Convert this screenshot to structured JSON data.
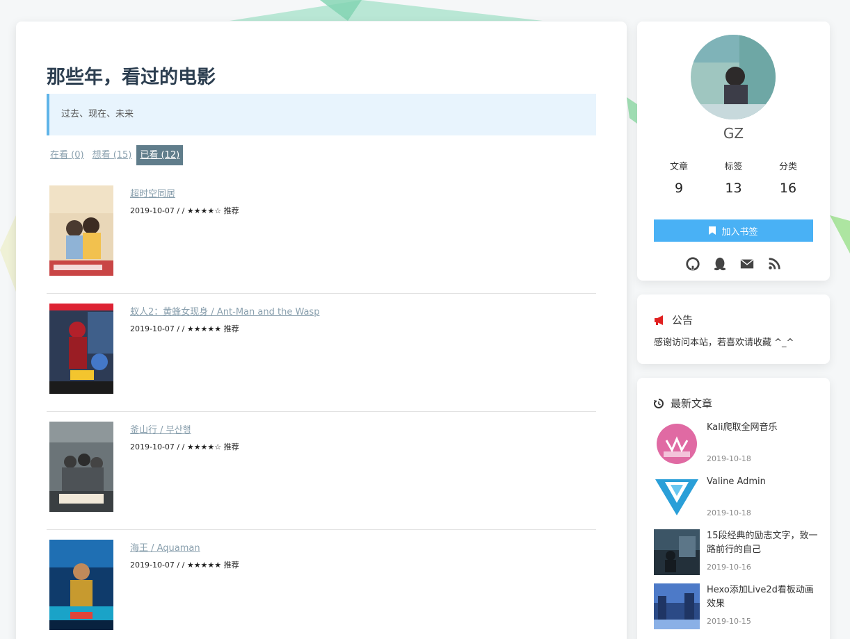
{
  "page": {
    "title": "那些年，看过的电影",
    "quote": "过去、现在、未来"
  },
  "tabs": [
    {
      "label": "在看 (0)",
      "active": false
    },
    {
      "label": "想看 (15)",
      "active": false
    },
    {
      "label": "已看 (12)",
      "active": true
    }
  ],
  "movies": [
    {
      "title": "超时空同居",
      "meta": "2019-10-07 / / ★★★★☆ 推荐"
    },
    {
      "title": "蚁人2：黄蜂女现身 / Ant-Man and the Wasp",
      "meta": "2019-10-07 / / ★★★★★ 推荐"
    },
    {
      "title": "釜山行 / 부산행",
      "meta": "2019-10-07 / / ★★★★☆ 推荐"
    },
    {
      "title": "海王 / Aquaman",
      "meta": "2019-10-07 / / ★★★★★ 推荐"
    }
  ],
  "profile": {
    "name": "GZ",
    "stats": [
      {
        "label": "文章",
        "value": "9"
      },
      {
        "label": "标签",
        "value": "13"
      },
      {
        "label": "分类",
        "value": "16"
      }
    ],
    "bookmark_label": "加入书签",
    "socials": [
      "github-icon",
      "qq-icon",
      "email-icon",
      "rss-icon"
    ]
  },
  "notice": {
    "heading": "公告",
    "text": "感谢访问本站，若喜欢请收藏 ^_^"
  },
  "recent": {
    "heading": "最新文章",
    "items": [
      {
        "title": "Kali爬取全网音乐",
        "date": "2019-10-18"
      },
      {
        "title": "Valine Admin",
        "date": "2019-10-18"
      },
      {
        "title": "15段经典的励志文字，致一路前行的自己",
        "date": "2019-10-16"
      },
      {
        "title": "Hexo添加Live2d看板动画效果",
        "date": "2019-10-15"
      }
    ]
  },
  "colors": {
    "accent": "#49b1f5",
    "tab_active": "#607d8b",
    "notice_icon": "#e02020"
  }
}
